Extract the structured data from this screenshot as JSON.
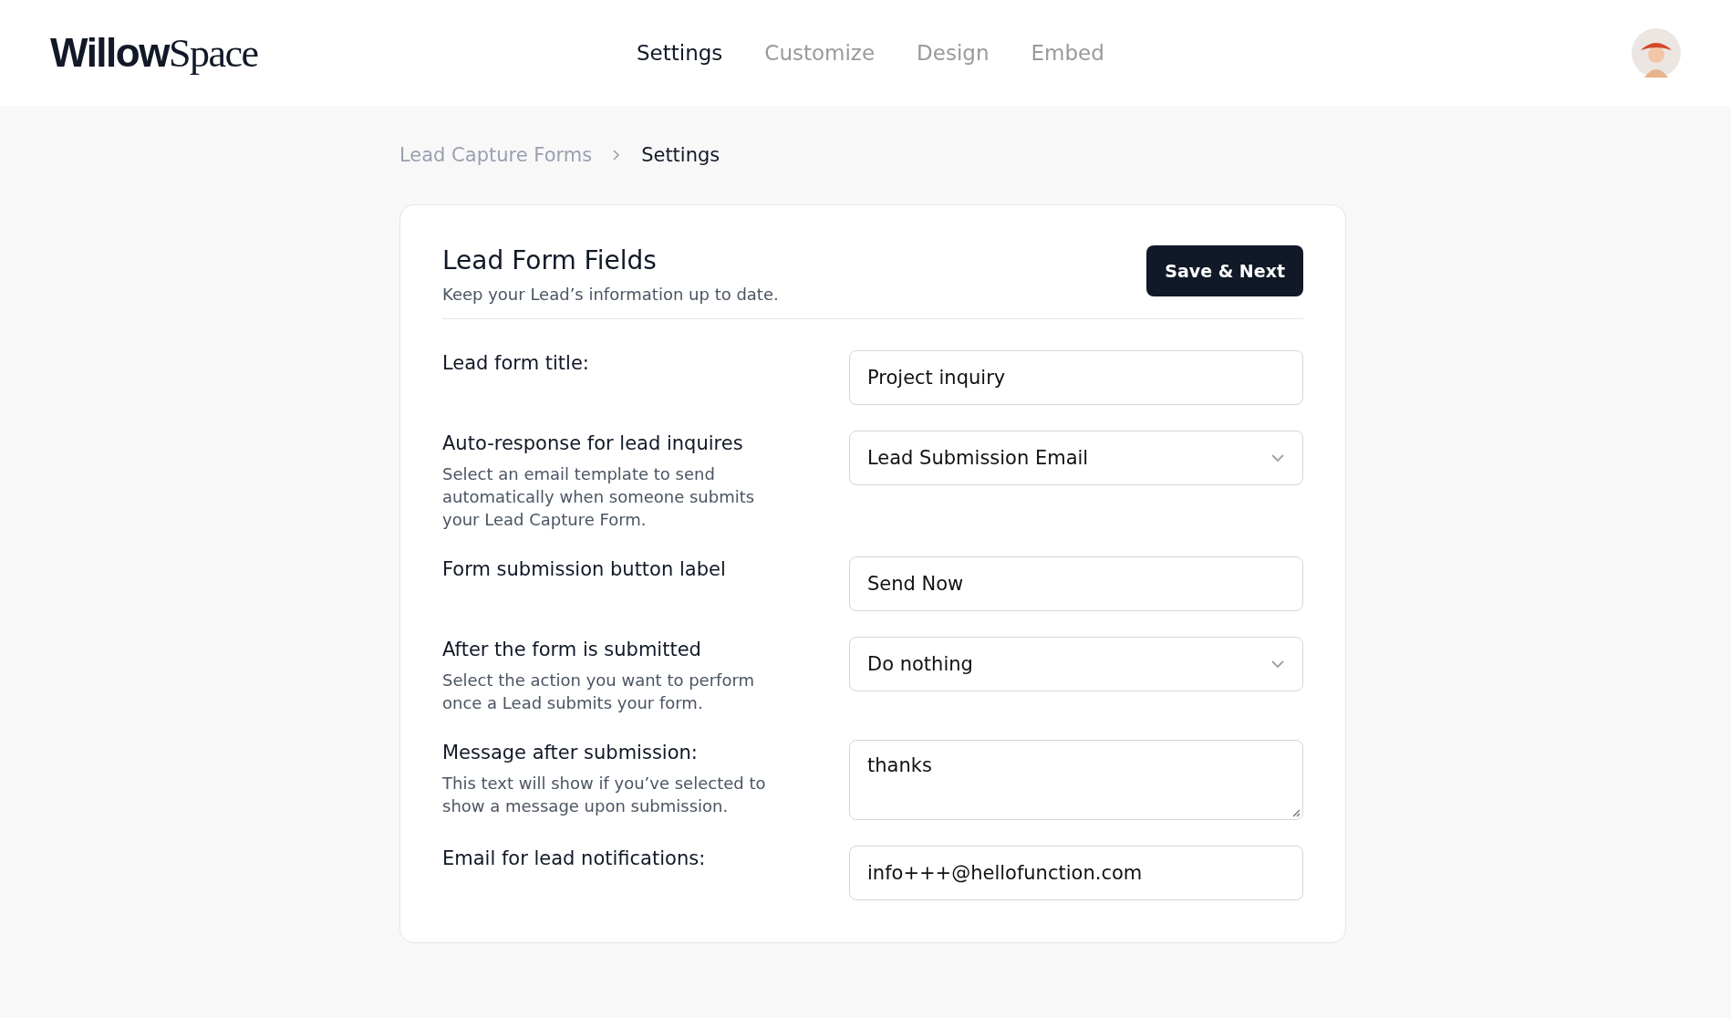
{
  "header": {
    "logo_bold": "Willow",
    "logo_light": "Space",
    "nav": [
      {
        "label": "Settings",
        "selected": true
      },
      {
        "label": "Customize",
        "selected": false
      },
      {
        "label": "Design",
        "selected": false
      },
      {
        "label": "Embed",
        "selected": false
      }
    ]
  },
  "breadcrumb": [
    "Lead Capture Forms",
    "Settings"
  ],
  "card": {
    "title": "Lead Form Fields",
    "subtitle": "Keep your Lead’s information up to date.",
    "button": "Save & Next",
    "fields": [
      {
        "kind": "text",
        "label": "Lead form title:",
        "value": "Project inquiry"
      },
      {
        "kind": "select",
        "label": "Auto-response for lead inquires",
        "description": "Select an email template to send automatically when someone submits your Lead Capture Form.",
        "value": "Lead Submission Email"
      },
      {
        "kind": "text",
        "label": "Form submission button label",
        "value": "Send Now"
      },
      {
        "kind": "select",
        "label": "After the form is submitted",
        "description": "Select the action you want to perform once a Lead submits your form.",
        "value": "Do nothing"
      },
      {
        "kind": "textarea",
        "label": "Message after submission:",
        "description": "This text will show if you’ve selected to show a message upon submission.",
        "value": "thanks"
      },
      {
        "kind": "text",
        "label": "Email for lead notifications:",
        "value": "info+++@hellofunction.com"
      }
    ]
  }
}
